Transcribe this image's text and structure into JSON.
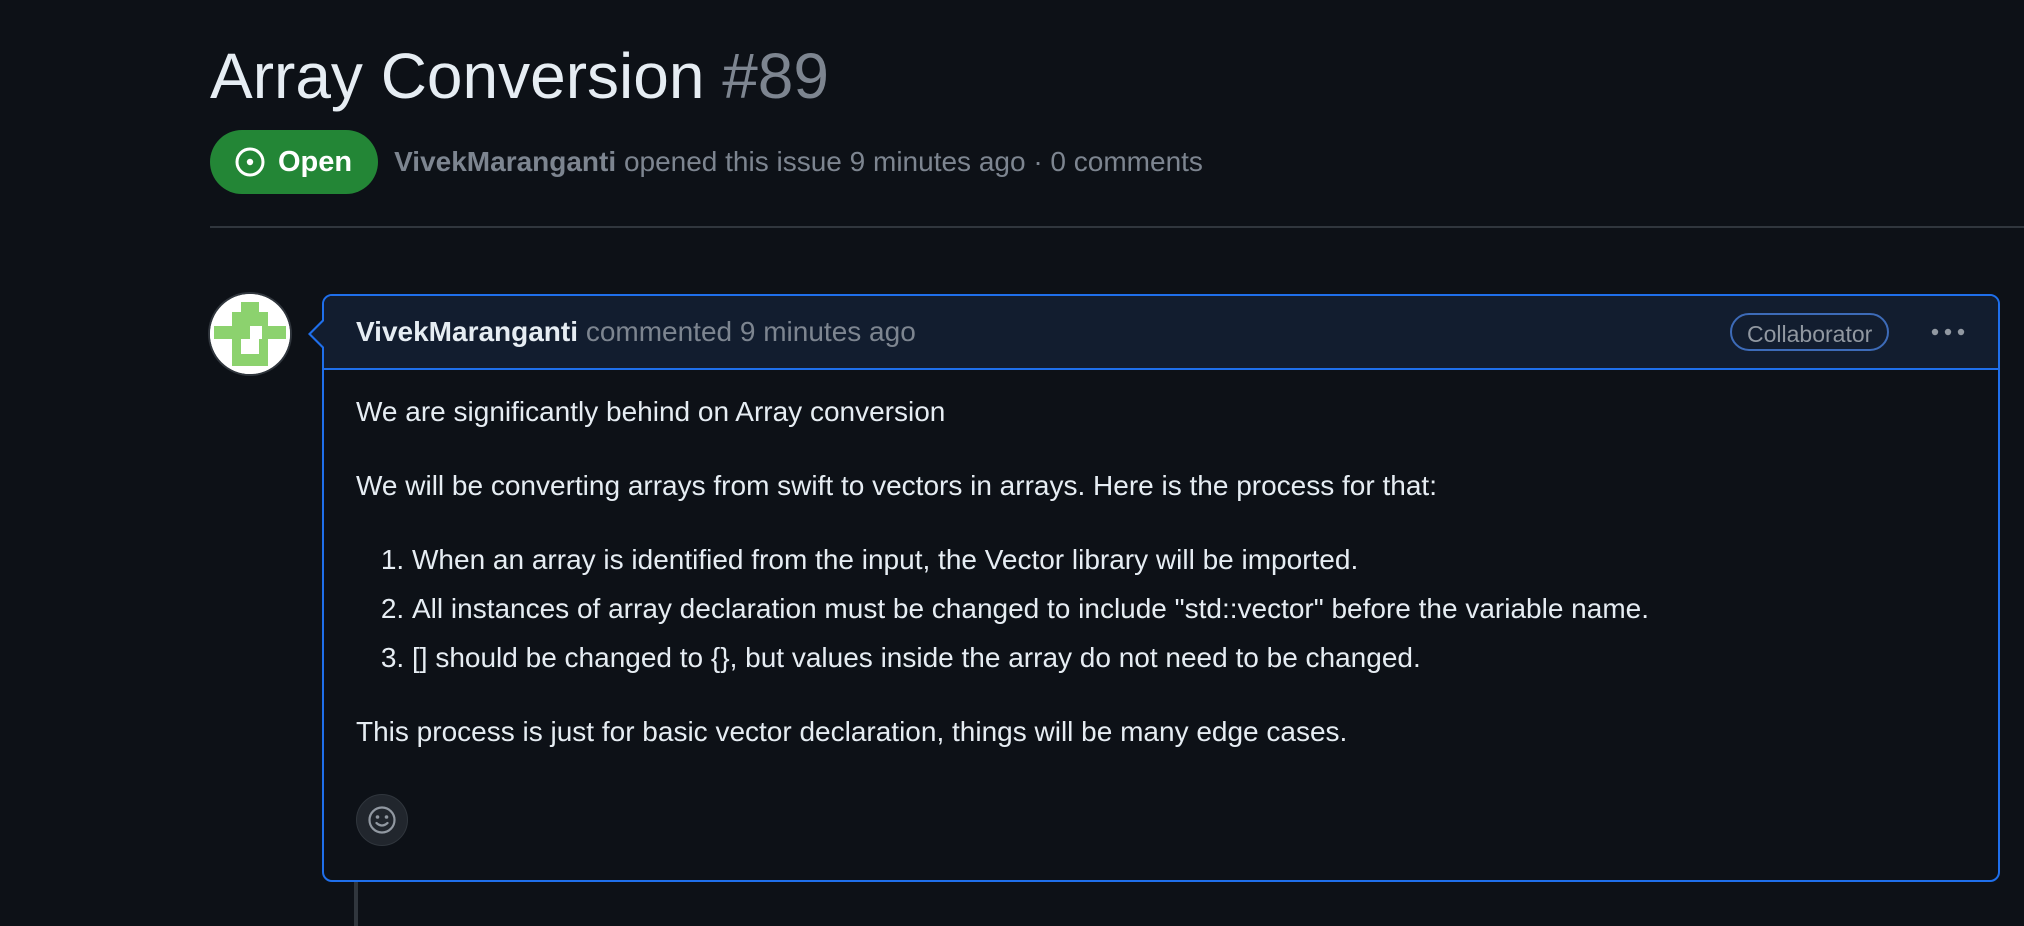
{
  "issue": {
    "title": "Array Conversion",
    "number": "#89",
    "state": "Open",
    "author": "VivekMaranganti",
    "opened_text": "opened this issue 9 minutes ago · 0 comments"
  },
  "comment": {
    "author": "VivekMaranganti",
    "action_text": "commented 9 minutes ago",
    "role_badge": "Collaborator",
    "body": {
      "intro": "We are significantly behind on Array conversion",
      "process_intro": "We will be converting arrays from swift to vectors in arrays. Here is the process for that:",
      "steps": [
        "When an array is identified from the input, the Vector library will be imported.",
        "All instances of array declaration must be changed to include \"std::vector\" before the variable name.",
        "[] should be changed to {}, but values inside the array do not need to be changed."
      ],
      "closing": "This process is just for basic vector declaration, things will be many edge cases."
    }
  },
  "icons": {
    "state": "issue-opened-icon",
    "more": "kebab-horizontal-icon",
    "reaction": "smiley-icon",
    "avatar": "identicon"
  },
  "colors": {
    "background": "#0d1117",
    "open_state": "#238636",
    "comment_border": "#1f6feb",
    "comment_header": "#121d2f",
    "muted_text": "#7d8590",
    "avatar_identicon": "#8cd26e"
  }
}
